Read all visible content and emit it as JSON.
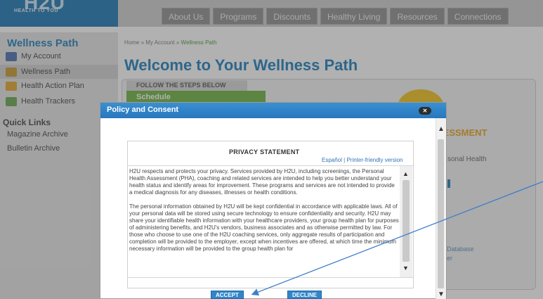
{
  "header": {
    "logo_mark": "H2U",
    "logo_tagline": "HEALTH TO YOU",
    "nav": [
      "About Us",
      "Programs",
      "Discounts",
      "Healthy Living",
      "Resources",
      "Connections"
    ]
  },
  "sidebar": {
    "title": "Wellness Path",
    "items": [
      {
        "label": "My Account",
        "icon": "account-icon",
        "color": "#4a6fb0"
      },
      {
        "label": "Wellness Path",
        "icon": "wellness-path-icon",
        "color": "#c89a2e"
      },
      {
        "label": "Health Action Plan",
        "icon": "action-plan-icon",
        "color": "#e2a72a"
      },
      {
        "label": "Health Trackers",
        "icon": "trackers-icon",
        "color": "#6aa84f"
      }
    ],
    "quick_links_title": "Quick Links",
    "quick_links": [
      "Magazine Archive",
      "Bulletin Archive"
    ]
  },
  "main": {
    "breadcrumb": {
      "home": "Home",
      "account": "My Account",
      "current": "Wellness Path",
      "sep": "»"
    },
    "heading": "Welcome to Your Wellness Path",
    "steps_label": "FOLLOW THE STEPS BELOW",
    "schedule_label": "Schedule",
    "assessment_fragment": "SESSMENT",
    "assessment_sub": "sonal Health",
    "db_fragment": "Database",
    "db_fragment2": "er"
  },
  "modal": {
    "title": "Policy and Consent",
    "close": "✕",
    "privacy_title": "PRIVACY STATEMENT",
    "link_espanol": "Español",
    "link_sep": "|",
    "link_printer": "Printer-friendly version",
    "paragraph1": "H2U respects and protects your privacy. Services provided by H2U, including screenings, the Personal Health Assessment (PHA), coaching and related services are intended to help you better understand your health status and identify areas for improvement. These programs and services are not intended to provide a medical diagnosis for any diseases, illnesses or health conditions.",
    "paragraph2": "The personal information obtained by H2U will be kept confidential in accordance with applicable laws. All of your personal data will be stored using secure technology to ensure confidentiality and security. H2U may share your identifiable health information with your healthcare providers, your group health plan for purposes of administering benefits, and H2U's vendors, business associates and as otherwise permitted by law. For those who choose to use one of the H2U coaching services, only aggregate results of participation and completion will be provided to the employer, except when incentives are offered, at which time the minimum necessary information will be provided to the group health plan for",
    "accept_label": "ACCEPT",
    "decline_label": "DECLINE"
  },
  "colors": {
    "brand_blue": "#1d7fbd",
    "accent_green": "#6db33f",
    "assessment_orange": "#e9a21b",
    "annotation_arrow": "#3f7fc9"
  }
}
